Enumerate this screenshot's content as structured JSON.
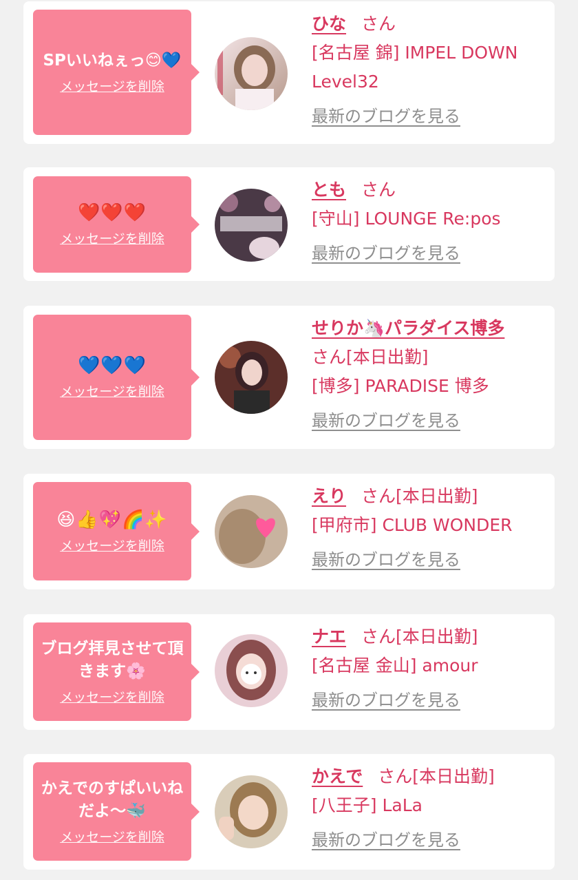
{
  "items": [
    {
      "message": "SPいいねぇっ😊💙",
      "delete_label": "メッセージを削除",
      "name": "ひな",
      "honorific": "さん",
      "status": "",
      "shop": "[名古屋 錦] IMPEL DOWN Level32",
      "blog_link": "最新のブログを見る"
    },
    {
      "message": "❤️❤️❤️",
      "delete_label": "メッセージを削除",
      "name": "とも",
      "honorific": "さん",
      "status": "",
      "shop": "[守山] LOUNGE Re:pos",
      "blog_link": "最新のブログを見る"
    },
    {
      "message": "💙💙💙",
      "delete_label": "メッセージを削除",
      "name": "せりか🦄パラダイス博多",
      "honorific": "さん",
      "status": "[本日出勤]",
      "shop": "[博多] PARADISE 博多",
      "blog_link": "最新のブログを見る"
    },
    {
      "message": "😆👍💖🌈✨",
      "delete_label": "メッセージを削除",
      "name": "えり",
      "honorific": "さん",
      "status": "[本日出勤]",
      "shop": "[甲府市] CLUB WONDER",
      "blog_link": "最新のブログを見る"
    },
    {
      "message": "ブログ拝見させて頂きます🌸",
      "delete_label": "メッセージを削除",
      "name": "ナエ",
      "honorific": "さん",
      "status": "[本日出勤]",
      "shop": "[名古屋 金山] amour",
      "blog_link": "最新のブログを見る"
    },
    {
      "message": "かえでのすぱいいねだよ〜🐳",
      "delete_label": "メッセージを削除",
      "name": "かえで",
      "honorific": "さん",
      "status": "[本日出勤]",
      "shop": "[八王子] LaLa",
      "blog_link": "最新のブログを見る"
    }
  ],
  "colors": {
    "bubble": "#f98498",
    "accent_text": "#d8385f",
    "link_gray": "#8e8e8e",
    "background": "#f1f1f1"
  }
}
